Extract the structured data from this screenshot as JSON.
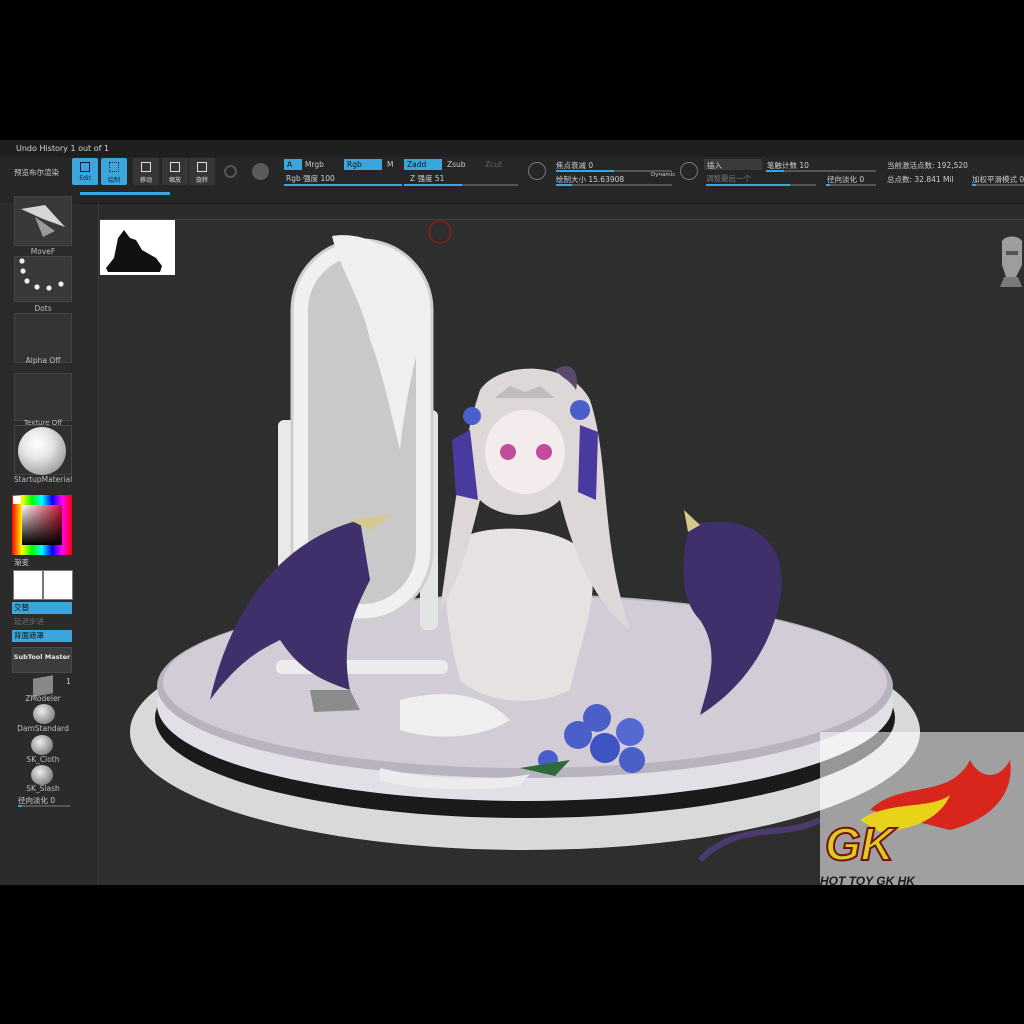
{
  "app": {
    "undo_history": "Undo History 1 out of 1",
    "preview_boolean": "预览布尔渲染"
  },
  "toolbar": {
    "edit_label": "Edit",
    "draw_label": "绘制",
    "move_label": "移动",
    "scale_label": "缩放",
    "rotate_label": "旋转",
    "a_label": "A",
    "mrgb_label": "Mrgb",
    "rgb_label": "Rgb",
    "m_label": "M",
    "rgb_intensity": "Rgb 强度 100",
    "zadd_label": "Zadd",
    "zsub_label": "Zsub",
    "zcut_label": "Zcut",
    "z_intensity": "Z 强度 51",
    "focal_shift": "焦点衰减 0",
    "draw_size": "绘制大小 15.63908",
    "dynamic_label": "Dynamic",
    "insert_label": "插入",
    "insert_sub": "调整最后一个",
    "stroke_count": "笔触计数 10",
    "radial_fade": "径向淡化 0",
    "active_points": "当前激活点数: 192,520",
    "total_points": "总点数: 32.841 Mil",
    "smooth_mode": "加权平滑模式 0"
  },
  "left_panel": {
    "brush_label": "MoveF",
    "stroke_label": "Dots",
    "alpha_label": "Alpha Off",
    "texture_label": "Texture Off",
    "material_label": "StartupMaterial",
    "gradient_label": "渐变",
    "switch_label": "交替",
    "delay_label": "延迟步进",
    "backface_label": "背面遮罩",
    "subtool_master": "SubTool Master",
    "zmodeler_label": "ZModeler",
    "zmodeler_count": "1",
    "damstandard_label": "DamStandard",
    "skcloth_label": "SK_Cloth",
    "skslash_label": "SK_Slash",
    "radial_fade_label": "径向淡化 0"
  },
  "watermark": {
    "brand": "GK",
    "tagline": "HOT TOY GK HK"
  },
  "colors": {
    "accent": "#3aa6dc",
    "canvas_bg": "#2e2e2e",
    "panel_bg": "#2b2b2b",
    "wing_purple": "#3f2f6b",
    "logo_yellow": "#e8d21a",
    "logo_red": "#d8261c"
  }
}
